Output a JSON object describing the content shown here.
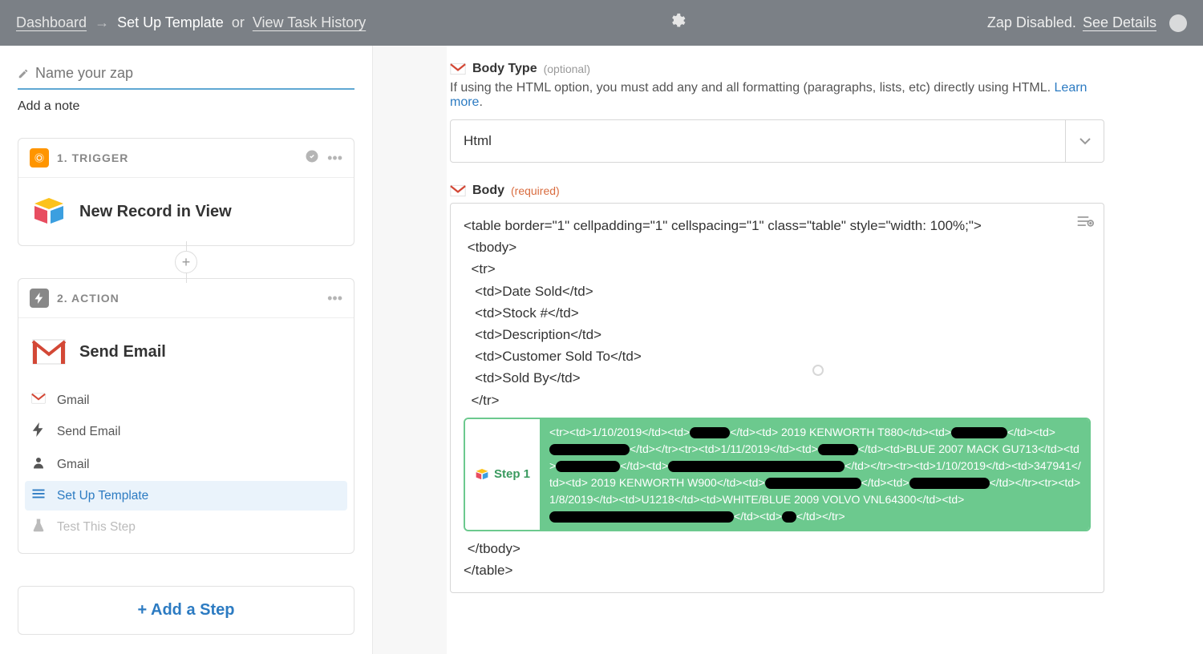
{
  "topbar": {
    "dashboard": "Dashboard",
    "arrow": "→",
    "current": "Set Up Template",
    "or": "or",
    "task_history": "View Task History",
    "status": "Zap Disabled.",
    "see_details": "See Details"
  },
  "sidebar": {
    "name_placeholder": "Name your zap",
    "add_note": "Add a note",
    "trigger": {
      "number_label": "1. TRIGGER",
      "name": "New Record in View"
    },
    "action": {
      "number_label": "2. ACTION",
      "name": "Send Email",
      "substeps": [
        {
          "icon": "gmail",
          "label": "Gmail"
        },
        {
          "icon": "bolt",
          "label": "Send Email"
        },
        {
          "icon": "person",
          "label": "Gmail"
        },
        {
          "icon": "list",
          "label": "Set Up Template"
        },
        {
          "icon": "flask",
          "label": "Test This Step"
        }
      ]
    },
    "add_step": "+ Add a Step"
  },
  "body_type": {
    "label": "Body Type",
    "hint": "(optional)",
    "help_text": "If using the HTML option, you must add any and all formatting (paragraphs, lists, etc) directly using HTML. ",
    "learn_more": "Learn more",
    "selected": "Html"
  },
  "body": {
    "label": "Body",
    "hint": "(required)",
    "code_lines": [
      "<table border=\"1\" cellpadding=\"1\" cellspacing=\"1\" class=\"table\" style=\"width: 100%;\">",
      " <tbody>",
      "  <tr>",
      "   <td>Date Sold</td>",
      "   <td>Stock #</td>",
      "   <td>Description</td>",
      "   <td>Customer Sold To</td>",
      "   <td>Sold By</td>",
      "  </tr>"
    ],
    "step_chip_label": "Step 1",
    "chip_text": "<tr><td>1/10/2019</td><td>████</td><td> 2019 KENWORTH T880</td><td>████████</td><td>████████████</td></tr><tr><td>1/11/2019</td><td>████</td><td>BLUE 2007 MACK GU713</td><td>████████</td><td>████</td></tr><tr><td>1/10/2019</td><td>347941</td><td> 2019 KENWORTH W900</td><td>████████████</td><td>████████</td></tr><tr><td>1/8/2019</td><td>U1218</td><td>WHITE/BLUE 2009 VOLVO VNL64300</td><td>████████████████████████</td><td>██</td></tr>",
    "closing_lines": [
      " </tbody>",
      "</table>"
    ]
  }
}
